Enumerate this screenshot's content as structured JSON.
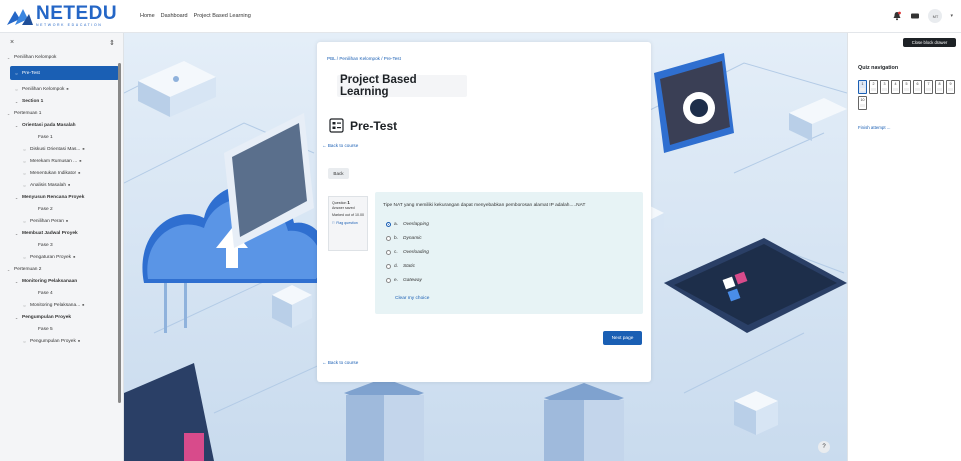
{
  "brand": {
    "name": "NETEDU",
    "tagline": "NETWORK EDUCATION"
  },
  "nav": {
    "links": [
      "Home",
      "Dashboard",
      "Project Based Learning"
    ]
  },
  "user": {
    "initials": "MT"
  },
  "drawer": {
    "close_glyph": "×",
    "expand_glyph": "⇕",
    "items": [
      {
        "label": "Penilihan Kelompok",
        "level": 0,
        "icon": "chevron-down",
        "active": false,
        "locked": false
      },
      {
        "label": "Pre-Test",
        "level": 1,
        "icon": "circle",
        "active": true,
        "locked": false
      },
      {
        "label": "Penilihan Kelompok",
        "level": 1,
        "icon": "circle",
        "active": false,
        "locked": true
      },
      {
        "label": "Section 1",
        "level": 1,
        "icon": "chevron-down",
        "active": false,
        "locked": false,
        "bold": true
      },
      {
        "label": "Pertemuan 1",
        "level": 0,
        "icon": "chevron-down",
        "active": false,
        "locked": false
      },
      {
        "label": "Orientasi pada Masalah",
        "level": 1,
        "icon": "chevron-down",
        "active": false,
        "locked": false,
        "bold": true
      },
      {
        "label": "Fase 1",
        "level": 3,
        "icon": "",
        "active": false,
        "locked": false
      },
      {
        "label": "Diskusi Orientasi Mas...",
        "level": 2,
        "icon": "circle",
        "active": false,
        "locked": true
      },
      {
        "label": "Merekam Rumusan ...",
        "level": 2,
        "icon": "circle",
        "active": false,
        "locked": true
      },
      {
        "label": "Menentukan Indikator",
        "level": 2,
        "icon": "circle",
        "active": false,
        "locked": true
      },
      {
        "label": "Analisis Masalah",
        "level": 2,
        "icon": "circle",
        "active": false,
        "locked": true
      },
      {
        "label": "Menyusun Rencana Proyek",
        "level": 1,
        "icon": "chevron-down",
        "active": false,
        "locked": false,
        "bold": true
      },
      {
        "label": "Fase 2",
        "level": 3,
        "icon": "",
        "active": false,
        "locked": false
      },
      {
        "label": "Penilihan Peran",
        "level": 2,
        "icon": "circle",
        "active": false,
        "locked": true
      },
      {
        "label": "Membuat Jadwal Proyek",
        "level": 1,
        "icon": "chevron-down",
        "active": false,
        "locked": false,
        "bold": true
      },
      {
        "label": "Fase 3",
        "level": 3,
        "icon": "",
        "active": false,
        "locked": false
      },
      {
        "label": "Pengaturan Proyek",
        "level": 2,
        "icon": "circle",
        "active": false,
        "locked": true
      },
      {
        "label": "Pertemuan 2",
        "level": 0,
        "icon": "chevron-down",
        "active": false,
        "locked": false
      },
      {
        "label": "Monitoring Pelaksanaan",
        "level": 1,
        "icon": "chevron-down",
        "active": false,
        "locked": false,
        "bold": true
      },
      {
        "label": "Fase 4",
        "level": 3,
        "icon": "",
        "active": false,
        "locked": false
      },
      {
        "label": "Monitoring Pelaksana...",
        "level": 2,
        "icon": "circle",
        "active": false,
        "locked": true
      },
      {
        "label": "Pengumpulan Proyek",
        "level": 1,
        "icon": "chevron-down",
        "active": false,
        "locked": false,
        "bold": true
      },
      {
        "label": "Fase 5",
        "level": 3,
        "icon": "",
        "active": false,
        "locked": false
      },
      {
        "label": "Pengumpulan Proyek",
        "level": 2,
        "icon": "circle",
        "active": false,
        "locked": true
      }
    ]
  },
  "page": {
    "breadcrumb": "PBL / Penilihan Kelompok / Pre-Test",
    "course_title": "Project Based Learning",
    "quiz_title": "Pre-Test",
    "back_to_course": "← Back to course",
    "back_button": "Back",
    "next_button": "Next page"
  },
  "question": {
    "number_label": "Question",
    "number": "1",
    "status": "Answer saved",
    "marks": "Marked out of 10.00",
    "flag_label": "Flag question",
    "text": "Tipe NAT yang memiliki kekurangan dapat menyebabkan pemborosan alamat IP adalah.....NAT",
    "options": [
      {
        "letter": "a.",
        "text": "Overlapping",
        "selected": true
      },
      {
        "letter": "b.",
        "text": "Dynamic",
        "selected": false
      },
      {
        "letter": "c.",
        "text": "Overloading",
        "selected": false
      },
      {
        "letter": "d.",
        "text": "Static",
        "selected": false
      },
      {
        "letter": "e.",
        "text": "Gateway",
        "selected": false
      }
    ],
    "clear_choice": "Clear my choice"
  },
  "quiz_nav": {
    "close_tooltip": "Close block drawer",
    "title": "Quiz navigation",
    "buttons": [
      "1",
      "2",
      "3",
      "4",
      "5",
      "6",
      "7",
      "8",
      "9",
      "10"
    ],
    "current": "1",
    "finish": "Finish attempt ..."
  },
  "help_glyph": "?",
  "colors": {
    "primary": "#1a5fb4",
    "brand": "#2466c6",
    "answer_bg": "#e7f3f5"
  }
}
